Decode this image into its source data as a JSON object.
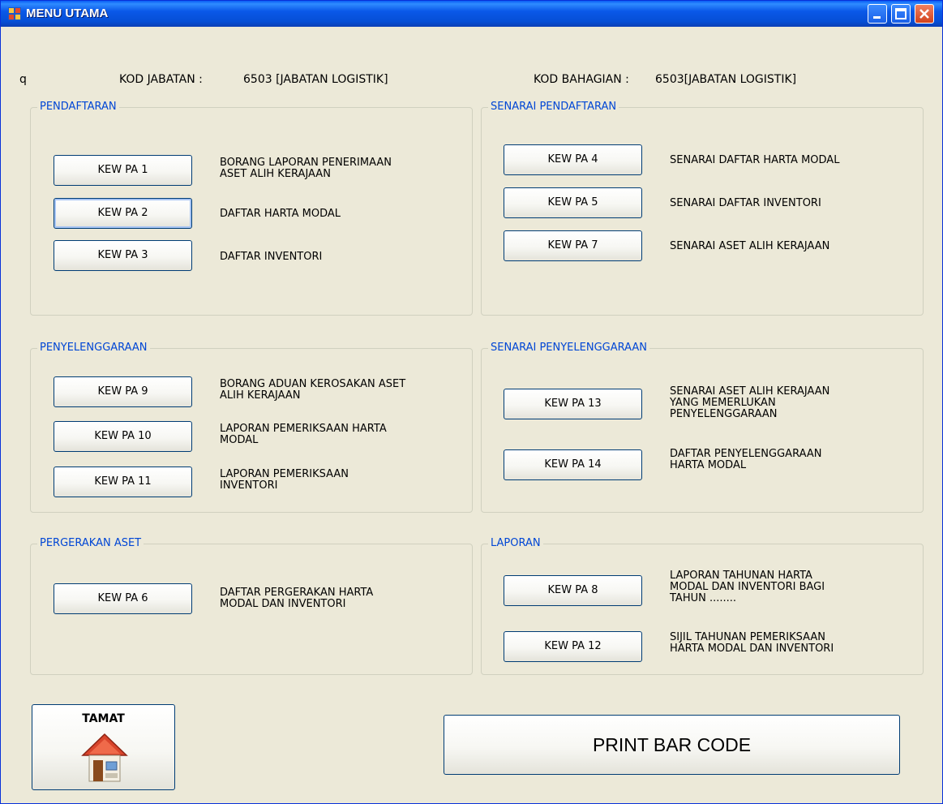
{
  "window": {
    "title": "MENU UTAMA",
    "icons": {
      "app": "form-app-icon",
      "minimize": "minimize-icon",
      "maximize": "maximize-icon",
      "close": "close-icon"
    }
  },
  "header": {
    "q_label": "q",
    "kod_jabatan_label": "KOD JABATAN :",
    "kod_jabatan_value": "6503 [JABATAN LOGISTIK]",
    "kod_bahagian_label": "KOD BAHAGIAN :",
    "kod_bahagian_value": "6503[JABATAN LOGISTIK]"
  },
  "groups": {
    "pendaftaran": {
      "label": "PENDAFTARAN",
      "items": [
        {
          "button": "KEW PA 1",
          "desc": "BORANG LAPORAN PENERIMAAN\nASET ALIH KERAJAAN"
        },
        {
          "button": "KEW PA 2",
          "desc": "DAFTAR HARTA MODAL"
        },
        {
          "button": "KEW PA 3",
          "desc": "DAFTAR INVENTORI"
        }
      ]
    },
    "senarai_pendaftaran": {
      "label": "SENARAI PENDAFTARAN",
      "items": [
        {
          "button": "KEW PA 4",
          "desc": "SENARAI DAFTAR HARTA MODAL"
        },
        {
          "button": "KEW PA 5",
          "desc": "SENARAI DAFTAR INVENTORI"
        },
        {
          "button": "KEW PA 7",
          "desc": "SENARAI ASET ALIH KERAJAAN"
        }
      ]
    },
    "penyelenggaraan": {
      "label": "PENYELENGGARAAN",
      "items": [
        {
          "button": "KEW PA 9",
          "desc": "BORANG ADUAN KEROSAKAN ASET\nALIH KERAJAAN"
        },
        {
          "button": "KEW PA 10",
          "desc": "LAPORAN PEMERIKSAAN HARTA\nMODAL"
        },
        {
          "button": "KEW PA 11",
          "desc": "LAPORAN PEMERIKSAAN\nINVENTORI"
        }
      ]
    },
    "senarai_penyelenggaraan": {
      "label": "SENARAI PENYELENGGARAAN",
      "items": [
        {
          "button": "KEW PA 13",
          "desc": "SENARAI ASET ALIH KERAJAAN\nYANG MEMERLUKAN\nPENYELENGGARAAN"
        },
        {
          "button": "KEW PA 14",
          "desc": "DAFTAR PENYELENGGARAAN\nHARTA MODAL"
        }
      ]
    },
    "pergerakan_aset": {
      "label": "PERGERAKAN ASET",
      "items": [
        {
          "button": "KEW PA 6",
          "desc": "DAFTAR PERGERAKAN HARTA\nMODAL DAN INVENTORI"
        }
      ]
    },
    "laporan": {
      "label": "LAPORAN",
      "items": [
        {
          "button": "KEW PA 8",
          "desc": "LAPORAN TAHUNAN HARTA\nMODAL DAN INVENTORI BAGI\nTAHUN ........"
        },
        {
          "button": "KEW PA 12",
          "desc": "SIJIL TAHUNAN PEMERIKSAAN\nHARTA MODAL DAN INVENTORI"
        }
      ]
    }
  },
  "footer": {
    "tamat_label": "TAMAT",
    "tamat_icon": "home-icon",
    "print_label": "PRINT BAR CODE"
  },
  "colors": {
    "group_label": "#0046d5",
    "form_bg": "#ece9d8",
    "titlebar": "#0a58e8"
  }
}
